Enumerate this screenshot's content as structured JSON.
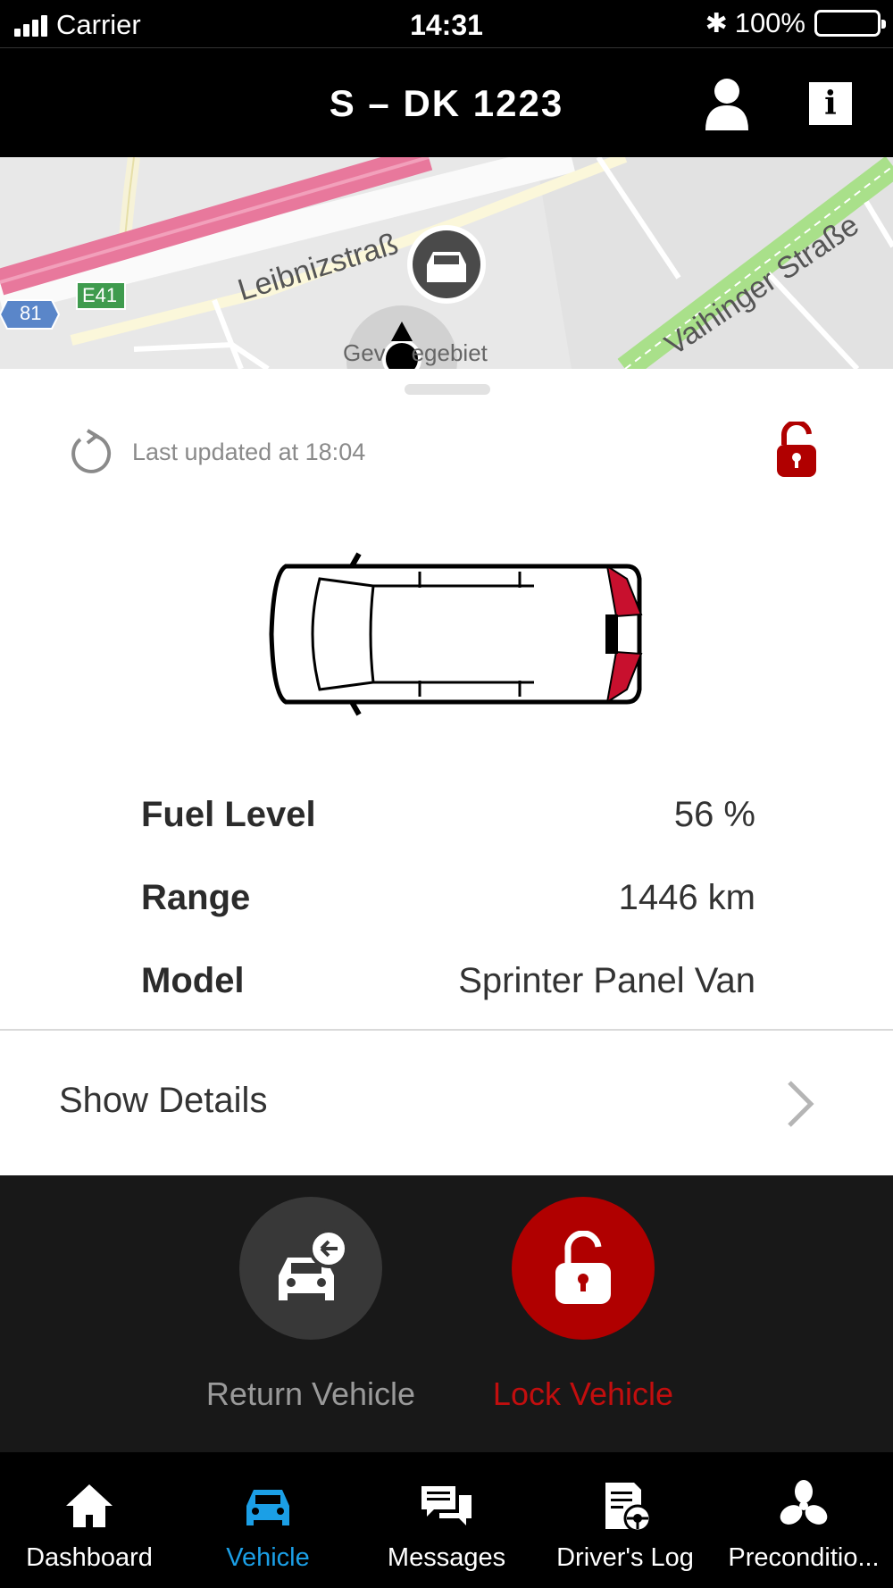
{
  "status_bar": {
    "carrier": "Carrier",
    "time": "14:31",
    "battery": "100%"
  },
  "header": {
    "title": "S – DK 1223",
    "icons": [
      "profile-icon",
      "info-icon"
    ]
  },
  "map": {
    "labels": {
      "street1": "Leibnizstraß",
      "street2": "Vaihinger Straße",
      "area": "Gev    egebiet",
      "highway_shield_blue": "81",
      "highway_shield_green": "E41"
    }
  },
  "vehicle": {
    "last_updated": "Last updated at 18:04",
    "lock_state_icon": "unlocked-padlock-icon",
    "stats": [
      {
        "label": "Fuel Level",
        "value": "56 %"
      },
      {
        "label": "Range",
        "value": "1446 km"
      },
      {
        "label": "Model",
        "value": "Sprinter Panel Van"
      }
    ],
    "details_label": "Show Details"
  },
  "actions": {
    "return_label": "Return Vehicle",
    "lock_label": "Lock Vehicle"
  },
  "tabs": [
    {
      "label": "Dashboard",
      "icon": "home-icon",
      "active": false
    },
    {
      "label": "Vehicle",
      "icon": "car-icon",
      "active": true
    },
    {
      "label": "Messages",
      "icon": "messages-icon",
      "active": false
    },
    {
      "label": "Driver's Log",
      "icon": "drivers-log-icon",
      "active": false
    },
    {
      "label": "Preconditio...",
      "icon": "fan-icon",
      "active": false
    }
  ],
  "colors": {
    "accent_blue": "#1b9fe6",
    "alert_red": "#b00000",
    "dark_bg": "#181818"
  }
}
